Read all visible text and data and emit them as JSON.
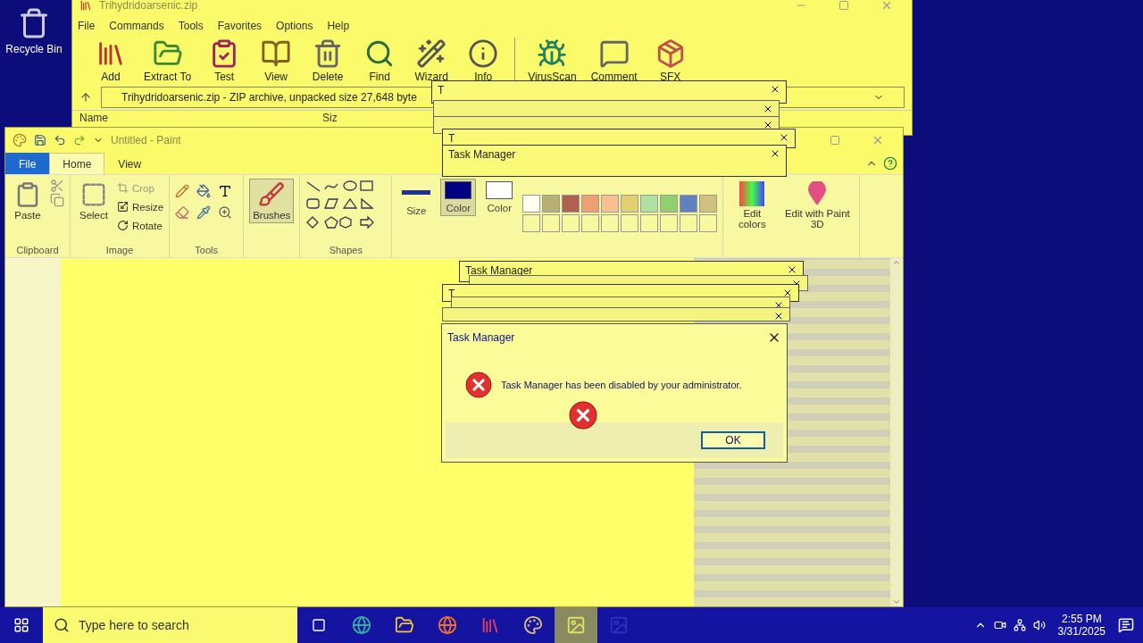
{
  "desktop_icons": [
    {
      "label": "Recycle Bin"
    }
  ],
  "archiver": {
    "title": "Trihydridoarsenic.zip",
    "menu": [
      "File",
      "Commands",
      "Tools",
      "Favorites",
      "Options",
      "Help"
    ],
    "toolbar": [
      "Add",
      "Extract To",
      "Test",
      "View",
      "Delete",
      "Find",
      "Wizard",
      "Info",
      "VirusScan",
      "Comment",
      "SFX"
    ],
    "address": "Trihydridoarsenic.zip - ZIP archive, unpacked size 27,648 byte",
    "columns": [
      "Name",
      "Siz"
    ]
  },
  "paint": {
    "title": "Untitled - Paint",
    "tabs": [
      {
        "label": "File",
        "selected": false,
        "kind": "file"
      },
      {
        "label": "Home",
        "selected": true,
        "kind": "tab"
      },
      {
        "label": "View",
        "selected": false,
        "kind": "tab"
      }
    ],
    "clipboard": {
      "paste": "Paste",
      "label": "Clipboard"
    },
    "image": {
      "select": "Select",
      "crop": {
        "label": "Crop",
        "disabled": true
      },
      "resize": {
        "label": "Resize",
        "disabled": false
      },
      "rotate": {
        "label": "Rotate",
        "disabled": false
      },
      "label": "Image"
    },
    "tools": {
      "label": "Tools"
    },
    "brushes": {
      "label": "Brushes",
      "selected": true
    },
    "shapes": {
      "label": "Shapes"
    },
    "size": "Size",
    "colors": [
      {
        "label": "Color",
        "selected": true,
        "color": "#000080"
      },
      {
        "label": "Color",
        "selected": false,
        "color": "#ffffff"
      }
    ],
    "palette": [
      {
        "color": "#fffff0"
      },
      {
        "color": "#b8b070"
      },
      {
        "color": "#b06050"
      },
      {
        "color": "#f0a070"
      },
      {
        "color": "#f8c090"
      },
      {
        "color": "#e0d070"
      },
      {
        "color": "#b0e0a0"
      },
      {
        "color": "#90d070"
      },
      {
        "color": "#6080c0"
      },
      {
        "color": "#d0c080"
      }
    ],
    "edit_colors": "Edit colors",
    "paint3d": "Edit with Paint 3D"
  },
  "ghost_dialogs": [
    {
      "title": "T"
    },
    {
      "kind": "frame"
    },
    {
      "kind": "frame"
    },
    {
      "title": "T"
    },
    {
      "title": "Task Manager"
    },
    {
      "title": "Task Manager"
    },
    {
      "kind": "frame"
    },
    {
      "title": "T"
    },
    {
      "kind": "frame"
    },
    {
      "kind": "frame"
    }
  ],
  "dialog": {
    "title": "Task Manager",
    "message": "Task Manager has been disabled by your administrator.",
    "button": "OK"
  },
  "taskbar": {
    "search_placeholder": "Type here to search",
    "time": "2:55 PM",
    "date": "3/31/2025"
  }
}
